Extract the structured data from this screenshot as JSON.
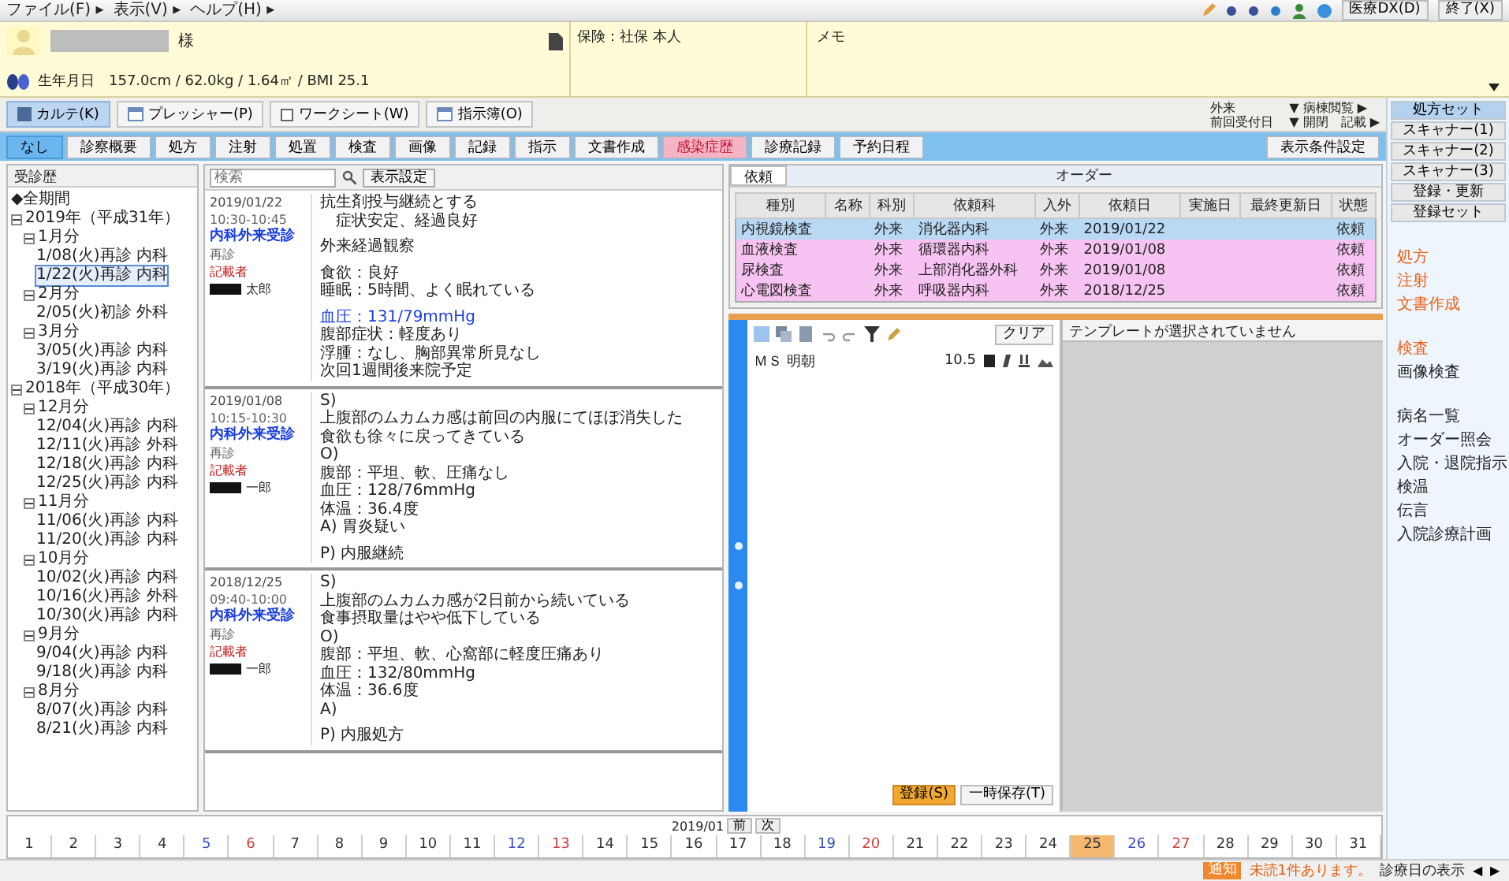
{
  "menu": {
    "items": [
      "ファイル(F) ▸",
      "表示(V) ▸",
      "ヘルプ(H) ▸"
    ],
    "buttons": [
      "医療DX(D)",
      "終了(X)"
    ]
  },
  "patient": {
    "honorific": "様",
    "info": "生年月日　157.0cm / 62.0kg / 1.64㎡ / BMI 25.1",
    "insurance": "保険：社保 本人",
    "memo_label": "メモ"
  },
  "toolbar": {
    "items": [
      {
        "label": "カルテ(K)",
        "kind": "toggle",
        "on": true
      },
      {
        "label": "プレッシャー(P)",
        "kind": "icon"
      },
      {
        "label": "ワークシート(W)",
        "kind": "checkbox",
        "checked": false
      },
      {
        "label": "指示簿(O)",
        "kind": "icon"
      }
    ],
    "filters": [
      {
        "label": "外来",
        "value": "▼ 病棟閲覧 ▶"
      },
      {
        "label": "前回受付日",
        "value": "▼ 開閉　記載 ▶"
      }
    ]
  },
  "tabs": {
    "items": [
      {
        "label": "なし",
        "selected": true,
        "alert": false
      },
      {
        "label": "診察概要",
        "selected": false,
        "alert": false
      },
      {
        "label": "処方",
        "selected": false,
        "alert": false
      },
      {
        "label": "注射",
        "selected": false,
        "alert": false
      },
      {
        "label": "処置",
        "selected": false,
        "alert": false
      },
      {
        "label": "検査",
        "selected": false,
        "alert": false
      },
      {
        "label": "画像",
        "selected": false,
        "alert": false
      },
      {
        "label": "記録",
        "selected": false,
        "alert": false
      },
      {
        "label": "指示",
        "selected": false,
        "alert": false
      },
      {
        "label": "文書作成",
        "selected": false,
        "alert": false
      },
      {
        "label": "感染症歴",
        "selected": false,
        "alert": true
      },
      {
        "label": "診療記録",
        "selected": false,
        "alert": false
      },
      {
        "label": "予約日程",
        "selected": false,
        "alert": false
      }
    ],
    "settings_button": "表示条件設定"
  },
  "tree": {
    "title": "受診歴",
    "items": [
      {
        "label": "◆全期間",
        "selected": false
      },
      {
        "label": "2019年（平成31年）",
        "expanded": true,
        "children": [
          {
            "label": "1月分",
            "expanded": true,
            "children": [
              {
                "label": "1/08(火)再診 内科",
                "selected": false
              },
              {
                "label": "1/22(火)再診 内科",
                "selected": true
              }
            ]
          },
          {
            "label": "2月分",
            "expanded": true,
            "children": [
              {
                "label": "2/05(火)初診 外科",
                "selected": false
              }
            ]
          },
          {
            "label": "3月分",
            "expanded": true,
            "children": [
              {
                "label": "3/05(火)再診 内科",
                "selected": false
              },
              {
                "label": "3/19(火)再診 内科",
                "selected": false
              }
            ]
          }
        ]
      },
      {
        "label": "2018年（平成30年）",
        "expanded": true,
        "children": [
          {
            "label": "12月分",
            "expanded": true,
            "children": [
              {
                "label": "12/04(火)再診 内科",
                "selected": false
              },
              {
                "label": "12/11(火)再診 外科",
                "selected": false
              },
              {
                "label": "12/18(火)再診 内科",
                "selected": false
              },
              {
                "label": "12/25(火)再診 内科",
                "selected": false
              }
            ]
          },
          {
            "label": "11月分",
            "expanded": true,
            "children": [
              {
                "label": "11/06(火)再診 内科",
                "selected": false
              },
              {
                "label": "11/20(火)再診 内科",
                "selected": false
              }
            ]
          },
          {
            "label": "10月分",
            "expanded": true,
            "children": [
              {
                "label": "10/02(火)再診 内科",
                "selected": false
              },
              {
                "label": "10/16(火)再診 外科",
                "selected": false
              },
              {
                "label": "10/30(火)再診 内科",
                "selected": false
              }
            ]
          },
          {
            "label": "9月分",
            "expanded": true,
            "children": [
              {
                "label": "9/04(火)再診 内科",
                "selected": false
              },
              {
                "label": "9/18(火)再診 内科",
                "selected": false
              }
            ]
          },
          {
            "label": "8月分",
            "expanded": true,
            "children": [
              {
                "label": "8/07(火)再診 内科",
                "selected": false
              },
              {
                "label": "8/21(火)再診 内科",
                "selected": false
              }
            ]
          }
        ]
      }
    ]
  },
  "notes": {
    "search": {
      "placeholder": "検索"
    },
    "settings_button": "表示設定",
    "entries": [
      {
        "meta": [
          {
            "text": "2019/01/22",
            "kind": "date"
          },
          {
            "text": "10:30-10:45",
            "kind": "time"
          },
          {
            "text": "内科外来受診",
            "kind": "dept"
          },
          {
            "text": "再診",
            "kind": "visit"
          },
          {
            "text": "記載者",
            "kind": "role"
          },
          {
            "text": "太郎",
            "kind": "author"
          }
        ],
        "lines": [
          {
            "text": "抗生剤投与継続とする"
          },
          {
            "text": "　症状安定、経過良好"
          },
          {
            "kind": "blank"
          },
          {
            "text": "外来経過観察"
          },
          {
            "kind": "blank"
          },
          {
            "text": "食欲：良好"
          },
          {
            "text": "睡眠：5時間、よく眠れている"
          },
          {
            "kind": "blank"
          },
          {
            "text": "血圧：131/79mmHg",
            "kind": "vital"
          },
          {
            "text": "腹部症状：軽度あり"
          },
          {
            "text": "浮腫：なし、胸部異常所見なし"
          },
          {
            "text": "次回1週間後来院予定"
          }
        ]
      },
      {
        "meta": [
          {
            "text": "2019/01/08",
            "kind": "date"
          },
          {
            "text": "10:15-10:30",
            "kind": "time"
          },
          {
            "text": "内科外来受診",
            "kind": "dept"
          },
          {
            "text": "再診",
            "kind": "visit"
          },
          {
            "text": "記載者",
            "kind": "role"
          },
          {
            "text": "一郎",
            "kind": "author"
          }
        ],
        "lines": [
          {
            "text": "S)"
          },
          {
            "text": "上腹部のムカムカ感は前回の内服にてほぼ消失した"
          },
          {
            "text": "食欲も徐々に戻ってきている"
          },
          {
            "text": "O)"
          },
          {
            "text": "腹部：平坦、軟、圧痛なし"
          },
          {
            "text": "血圧：128/76mmHg"
          },
          {
            "text": "体温：36.4度"
          },
          {
            "text": "A) 胃炎疑い"
          },
          {
            "kind": "blank"
          },
          {
            "text": "P) 内服継続"
          }
        ]
      },
      {
        "meta": [
          {
            "text": "2018/12/25",
            "kind": "date"
          },
          {
            "text": "09:40-10:00",
            "kind": "time"
          },
          {
            "text": "内科外来受診",
            "kind": "dept"
          },
          {
            "text": "再診",
            "kind": "visit"
          },
          {
            "text": "記載者",
            "kind": "role"
          },
          {
            "text": "一郎",
            "kind": "author"
          }
        ],
        "lines": [
          {
            "text": "S)"
          },
          {
            "text": "上腹部のムカムカ感が2日前から続いている"
          },
          {
            "text": "食事摂取量はやや低下している"
          },
          {
            "text": "O)"
          },
          {
            "text": "腹部：平坦、軟、心窩部に軽度圧痛あり"
          },
          {
            "text": "血圧：132/80mmHg"
          },
          {
            "text": "体温：36.6度"
          },
          {
            "text": "A)"
          },
          {
            "kind": "blank"
          },
          {
            "text": "P) 内服処方"
          }
        ]
      }
    ]
  },
  "orders": {
    "tab": "依頼",
    "title": "オーダー",
    "columns": [
      "種別",
      "名称",
      "科別",
      "依頼科",
      "入外",
      "依頼日",
      "実施日",
      "最終更新日",
      "状態"
    ],
    "rows": [
      {
        "cells": [
          "内視鏡検査",
          null,
          "外来",
          "消化器内科",
          "外来",
          "2019/01/22",
          null,
          null,
          "依頼"
        ],
        "selected": true
      },
      {
        "cells": [
          "血液検査",
          null,
          "外来",
          "循環器内科",
          "外来",
          "2019/01/08",
          null,
          null,
          "依頼"
        ],
        "selected": false,
        "color": "#f7c3f2"
      },
      {
        "cells": [
          "尿検査",
          null,
          "外来",
          "上部消化器外科",
          "外来",
          "2019/01/08",
          null,
          null,
          "依頼"
        ],
        "selected": false,
        "color": "#f7c3f2"
      },
      {
        "cells": [
          "心電図検査",
          null,
          "外来",
          "呼吸器内科",
          "外来",
          "2018/12/25",
          null,
          null,
          "依頼"
        ],
        "selected": false,
        "color": "#f7c3f2"
      }
    ]
  },
  "editor": {
    "clear_button": "クリア",
    "font": "ＭＳ 明朝",
    "font_size": "10.5",
    "save_button": "登録(S)",
    "draft_button": "一時保存(T)",
    "preview_title": "テンプレートが選択されていません"
  },
  "sidebar": {
    "buttons": [
      {
        "label": "処方セット",
        "selected": true
      },
      {
        "label": "スキャナー(1)",
        "selected": false
      },
      {
        "label": "スキャナー(2)",
        "selected": false
      },
      {
        "label": "スキャナー(3)",
        "selected": false
      },
      {
        "label": "登録・更新",
        "selected": false
      },
      {
        "label": "登録セット",
        "selected": false
      }
    ],
    "link_groups": [
      [
        {
          "label": "処方",
          "color": "#e8641e"
        },
        {
          "label": "注射",
          "color": "#e8641e"
        },
        {
          "label": "文書作成",
          "color": "#e8641e"
        }
      ],
      [
        {
          "label": "検査",
          "color": "#e8641e"
        },
        {
          "label": "画像検査",
          "color": "#222222"
        }
      ],
      [
        {
          "label": "病名一覧",
          "color": "#222222"
        },
        {
          "label": "オーダー照会",
          "color": "#222222"
        },
        {
          "label": "入院・退院指示",
          "color": "#222222"
        },
        {
          "label": "検温",
          "color": "#222222"
        },
        {
          "label": "伝言",
          "color": "#222222"
        },
        {
          "label": "入院診療計画",
          "color": "#222222"
        }
      ]
    ]
  },
  "dates": {
    "month": "2019/01",
    "prev_button": "前",
    "next_button": "次",
    "days": [
      {
        "label": "1",
        "selected": false
      },
      {
        "label": "2",
        "selected": false
      },
      {
        "label": "3",
        "selected": false
      },
      {
        "label": "4",
        "selected": false
      },
      {
        "label": "5",
        "selected": false,
        "color": "#3b4fc4"
      },
      {
        "label": "6",
        "selected": false,
        "color": "#d04040"
      },
      {
        "label": "7",
        "selected": false
      },
      {
        "label": "8",
        "selected": false
      },
      {
        "label": "9",
        "selected": false
      },
      {
        "label": "10",
        "selected": false
      },
      {
        "label": "11",
        "selected": false
      },
      {
        "label": "12",
        "selected": false,
        "color": "#3b4fc4"
      },
      {
        "label": "13",
        "selected": false,
        "color": "#d04040"
      },
      {
        "label": "14",
        "selected": false
      },
      {
        "label": "15",
        "selected": false
      },
      {
        "label": "16",
        "selected": false
      },
      {
        "label": "17",
        "selected": false
      },
      {
        "label": "18",
        "selected": false
      },
      {
        "label": "19",
        "selected": false,
        "color": "#3b4fc4"
      },
      {
        "label": "20",
        "selected": false,
        "color": "#d04040"
      },
      {
        "label": "21",
        "selected": false
      },
      {
        "label": "22",
        "selected": false
      },
      {
        "label": "23",
        "selected": false
      },
      {
        "label": "24",
        "selected": false
      },
      {
        "label": "25",
        "selected": true
      },
      {
        "label": "26",
        "selected": false,
        "color": "#3b4fc4"
      },
      {
        "label": "27",
        "selected": false,
        "color": "#d04040"
      },
      {
        "label": "28",
        "selected": false
      },
      {
        "label": "29",
        "selected": false
      },
      {
        "label": "30",
        "selected": false
      },
      {
        "label": "31",
        "selected": false
      }
    ]
  },
  "status_bar": {
    "badge": "通知",
    "message": "未読1件あります。",
    "label": "診療日の表示",
    "prev": "◀",
    "next": "▶"
  }
}
